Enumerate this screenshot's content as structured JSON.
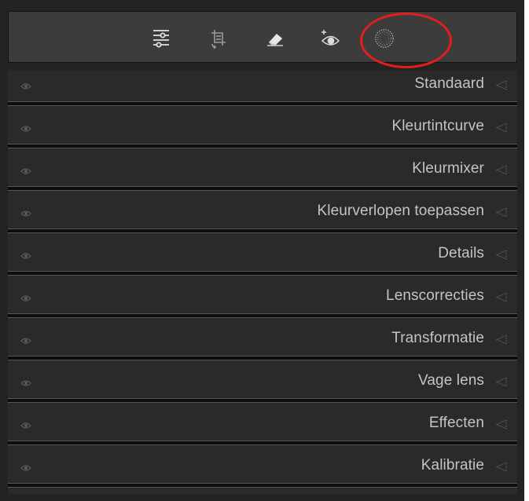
{
  "toolbar": {
    "tools": [
      {
        "name": "basic-adjust-tool",
        "icon": "sliders-icon",
        "active": true
      },
      {
        "name": "crop-tool",
        "icon": "crop-rotate-icon",
        "active": false
      },
      {
        "name": "healing-tool",
        "icon": "eraser-icon",
        "active": false
      },
      {
        "name": "red-eye-tool",
        "icon": "red-eye-icon",
        "active": false
      },
      {
        "name": "masking-tool",
        "icon": "mask-circle-icon",
        "active": false,
        "highlighted": true
      }
    ],
    "highlight_color": "#e41e1e"
  },
  "sections": [
    {
      "label": "Standaard"
    },
    {
      "label": "Kleurtintcurve"
    },
    {
      "label": "Kleurmixer"
    },
    {
      "label": "Kleurverlopen toepassen"
    },
    {
      "label": "Details"
    },
    {
      "label": "Lenscorrecties"
    },
    {
      "label": "Transformatie"
    },
    {
      "label": "Vage lens"
    },
    {
      "label": "Effecten"
    },
    {
      "label": "Kalibratie"
    }
  ],
  "colors": {
    "panel_bg": "#232323",
    "toolbar_bg": "#3c3c3c",
    "text": "#c4c4c4",
    "icon": "#d8d8d8"
  }
}
